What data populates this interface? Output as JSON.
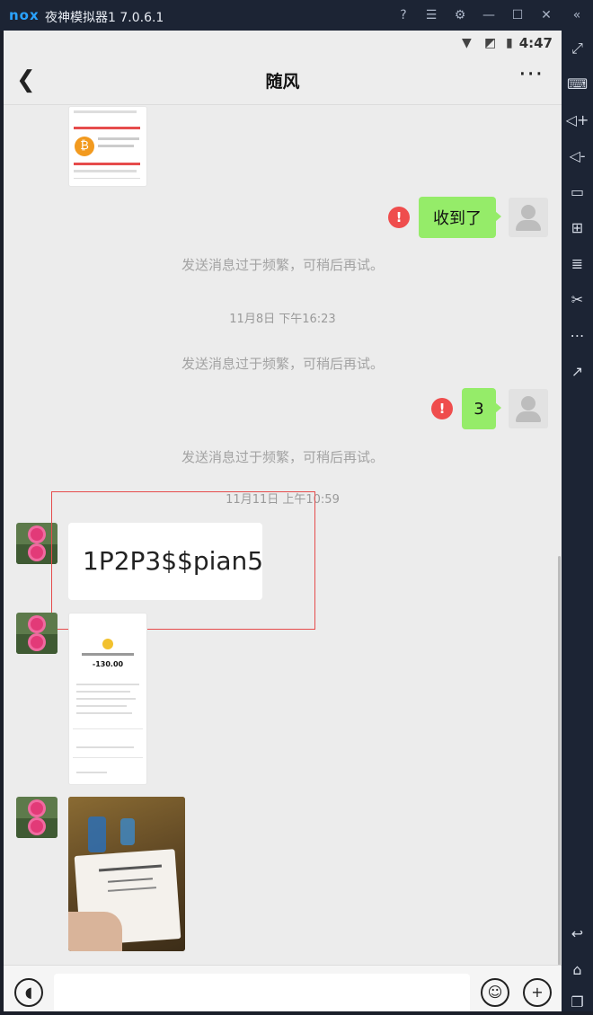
{
  "emulator": {
    "logo": "nox",
    "title": "夜神模拟器1 7.0.6.1",
    "controls": [
      "help-icon",
      "menu-icon",
      "settings-icon",
      "minimize-icon",
      "maximize-icon",
      "close-icon",
      "collapse-icon"
    ]
  },
  "statusbar": {
    "time": "4:47"
  },
  "chat": {
    "title": "随风",
    "messages": [
      {
        "kind": "sent",
        "text": "收到了",
        "failed": true
      },
      {
        "kind": "system",
        "text": "发送消息过于频繁，可稍后再试。"
      },
      {
        "kind": "time",
        "text": "11月8日 下午16:23"
      },
      {
        "kind": "system",
        "text": "发送消息过于频繁，可稍后再试。"
      },
      {
        "kind": "sent",
        "text": "3",
        "failed": true
      },
      {
        "kind": "system",
        "text": "发送消息过于频繁，可稍后再试。"
      },
      {
        "kind": "time",
        "text": "11月11日 上午10:59"
      },
      {
        "kind": "received",
        "text": "1P2P3$$pian5"
      },
      {
        "kind": "received-image",
        "amount": "-130.00"
      },
      {
        "kind": "received-image",
        "content": "photo"
      }
    ]
  },
  "error_mark": "!",
  "sidebar_tools": [
    "fullscreen-icon",
    "keyboard-icon",
    "volume-up-icon",
    "volume-down-icon",
    "screen-icon",
    "apk-icon",
    "layers-icon",
    "scissors-icon",
    "more-icon",
    "export-icon",
    "back-icon",
    "home-icon",
    "recents-icon"
  ]
}
